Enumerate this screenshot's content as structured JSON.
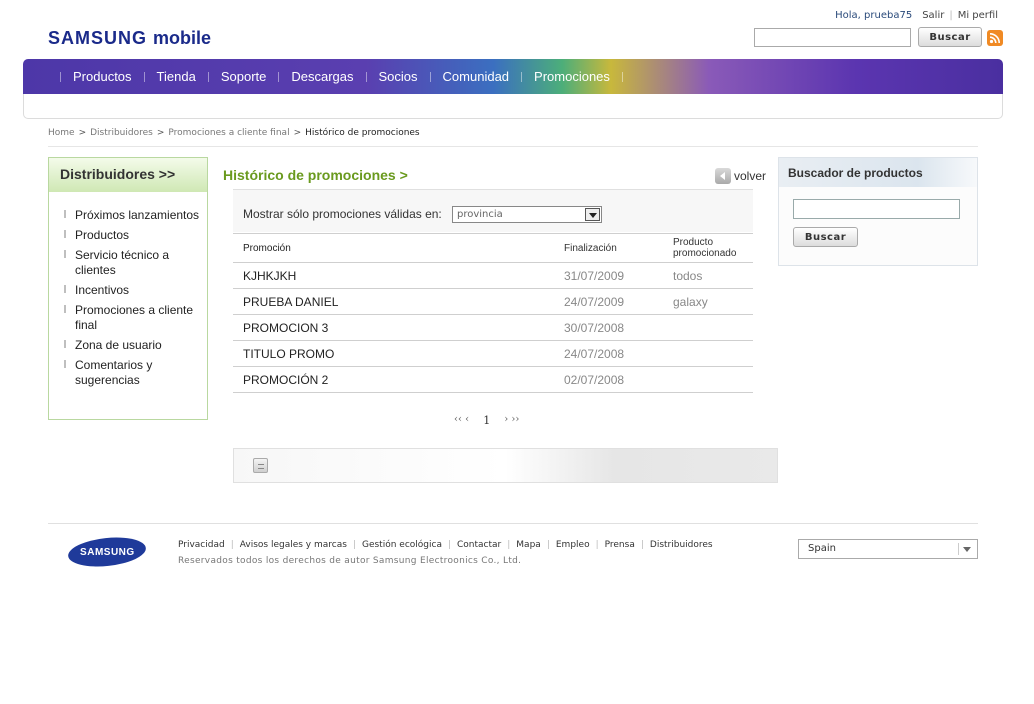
{
  "header": {
    "logo_brand": "SAMSUNG",
    "logo_suffix": "mobile",
    "greeting": "Hola, prueba75",
    "logout": "Salir",
    "profile": "Mi perfil",
    "search_value": "",
    "search_button": "Buscar",
    "rss_icon": "rss-feed-icon"
  },
  "nav": {
    "items": [
      "Productos",
      "Tienda",
      "Soporte",
      "Descargas",
      "Socios",
      "Comunidad",
      "Promociones"
    ]
  },
  "breadcrumb": {
    "items": [
      "Home",
      "Distribuidores",
      "Promociones a cliente final",
      "Histórico de promociones"
    ]
  },
  "sidebar": {
    "title": "Distribuidores >>",
    "items": [
      "Próximos lanzamientos",
      "Productos",
      "Servicio técnico a clientes",
      "Incentivos",
      "Promociones a cliente final",
      "Zona de usuario",
      "Comentarios y sugerencias"
    ]
  },
  "main": {
    "title": "Histórico de promociones >",
    "back_label": "volver",
    "filter_label": "Mostrar sólo promociones válidas en:",
    "filter_value": "provincia",
    "columns": [
      "Promoción",
      "Finalización",
      "Producto promocionado"
    ],
    "rows": [
      {
        "promocion": "KJHKJKH",
        "finalizacion": "31/07/2009",
        "producto": "todos"
      },
      {
        "promocion": "PRUEBA DANIEL",
        "finalizacion": "24/07/2009",
        "producto": "galaxy"
      },
      {
        "promocion": "PROMOCION 3",
        "finalizacion": "30/07/2008",
        "producto": ""
      },
      {
        "promocion": "TITULO PROMO",
        "finalizacion": "24/07/2008",
        "producto": ""
      },
      {
        "promocion": "PROMOCIÓN 2",
        "finalizacion": "02/07/2008",
        "producto": ""
      }
    ],
    "pager": {
      "first": "‹‹ ‹",
      "page": "1",
      "last": "› ››"
    }
  },
  "product_search": {
    "title": "Buscador de productos",
    "input_value": "",
    "button": "Buscar"
  },
  "footer": {
    "logo_text": "SAMSUNG",
    "links": [
      "Privacidad",
      "Avisos legales y marcas",
      "Gestión ecológica",
      "Contactar",
      "Mapa",
      "Empleo",
      "Prensa",
      "Distribuidores"
    ],
    "copyright": "Reservados todos los derechos de autor Samsung Electroonics Co., Ltd.",
    "country": "Spain"
  }
}
